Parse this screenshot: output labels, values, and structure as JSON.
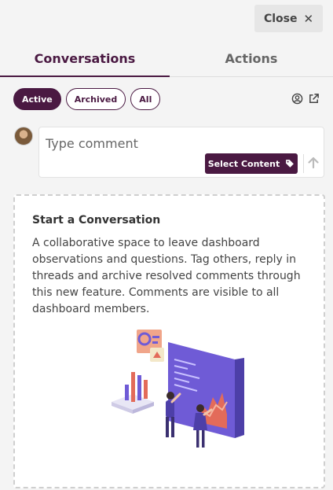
{
  "header": {
    "close_label": "Close",
    "close_icon": "close-icon"
  },
  "tabs": [
    {
      "label": "Conversations",
      "active": true
    },
    {
      "label": "Actions",
      "active": false
    }
  ],
  "filters": [
    {
      "label": "Active",
      "active": true
    },
    {
      "label": "Archived",
      "active": false
    },
    {
      "label": "All",
      "active": false
    }
  ],
  "toolbar_icons": [
    "user-circle-icon",
    "external-link-icon"
  ],
  "comment": {
    "placeholder": "Type comment",
    "value": "",
    "select_content_label": "Select Content",
    "tag_icon": "tag-icon",
    "send_icon": "arrow-up-icon"
  },
  "empty_state": {
    "title": "Start a Conversation",
    "description": "A collaborative space to leave dashboard observations and questions. Tag others, reply in threads and archive resolved comments through this new feature. Comments are visible to all dashboard members."
  },
  "colors": {
    "accent": "#4a1942",
    "background": "#f4f4f4"
  }
}
